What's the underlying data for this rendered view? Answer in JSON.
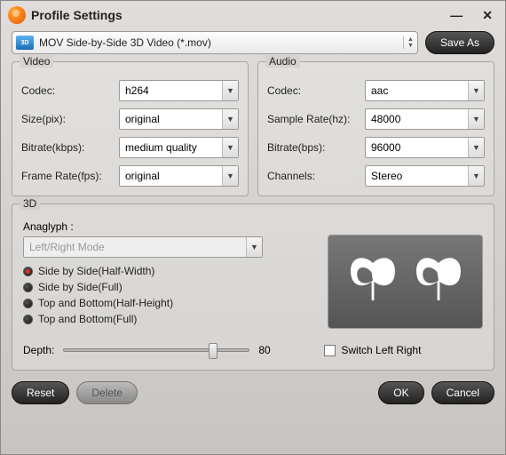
{
  "window": {
    "title": "Profile Settings"
  },
  "profile": {
    "selected": "MOV Side-by-Side 3D Video (*.mov)",
    "save_as": "Save As"
  },
  "video": {
    "group_label": "Video",
    "codec_label": "Codec:",
    "codec_value": "h264",
    "size_label": "Size(pix):",
    "size_value": "original",
    "bitrate_label": "Bitrate(kbps):",
    "bitrate_value": "medium quality",
    "framerate_label": "Frame Rate(fps):",
    "framerate_value": "original"
  },
  "audio": {
    "group_label": "Audio",
    "codec_label": "Codec:",
    "codec_value": "aac",
    "samplerate_label": "Sample Rate(hz):",
    "samplerate_value": "48000",
    "bitrate_label": "Bitrate(bps):",
    "bitrate_value": "96000",
    "channels_label": "Channels:",
    "channels_value": "Stereo"
  },
  "three_d": {
    "group_label": "3D",
    "anaglyph_label": "Anaglyph :",
    "anaglyph_value": "Left/Right Mode",
    "modes": [
      "Side by Side(Half-Width)",
      "Side by Side(Full)",
      "Top and Bottom(Half-Height)",
      "Top and Bottom(Full)"
    ],
    "selected_mode_index": 0,
    "depth_label": "Depth:",
    "depth_value": "80",
    "switch_label": "Switch Left Right",
    "switch_checked": false
  },
  "footer": {
    "reset": "Reset",
    "delete": "Delete",
    "ok": "OK",
    "cancel": "Cancel"
  }
}
